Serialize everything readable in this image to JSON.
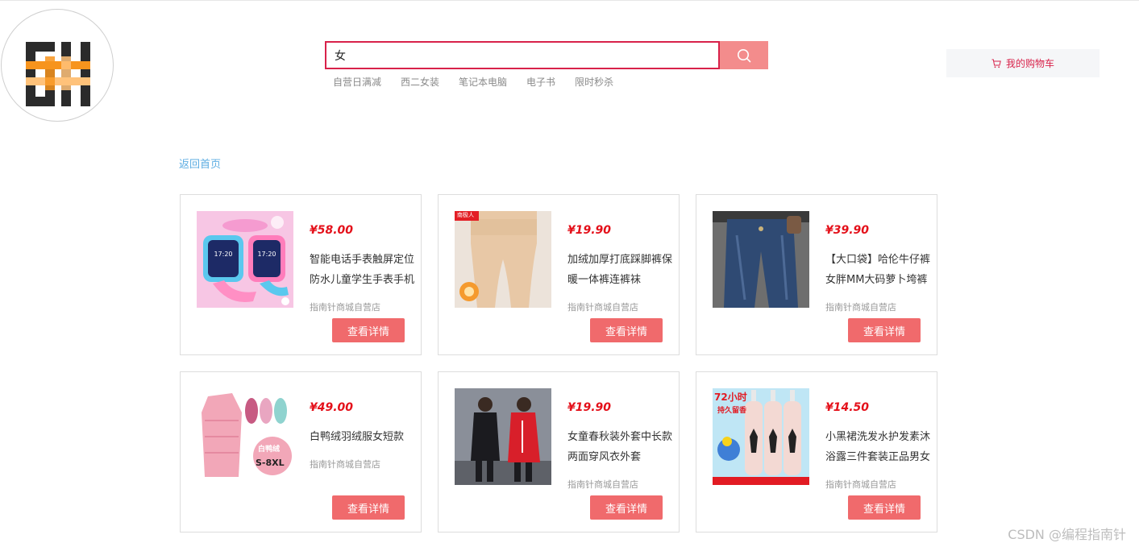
{
  "search": {
    "value": "女",
    "hot_words": [
      "自营日满减",
      "西二女装",
      "笔记本电脑",
      "电子书",
      "限时秒杀"
    ]
  },
  "cart": {
    "label": "我的购物车"
  },
  "nav": {
    "back_label": "返回首页"
  },
  "products": [
    {
      "price": "¥58.00",
      "name": "智能电话手表触屏定位防水儿童学生手表手机",
      "shop": "指南针商城自营店",
      "button": "查看详情"
    },
    {
      "price": "¥19.90",
      "name": "加绒加厚打底踩脚裤保暖一体裤连裤袜",
      "shop": "指南针商城自营店",
      "button": "查看详情",
      "badge": "南极人"
    },
    {
      "price": "¥39.90",
      "name": "【大口袋】哈伦牛仔裤女胖MM大码萝卜垮裤",
      "shop": "指南针商城自营店",
      "button": "查看详情"
    },
    {
      "price": "¥49.00",
      "name": "白鸭绒羽绒服女短款",
      "shop": "指南针商城自营店",
      "button": "查看详情",
      "tag_top": "白鸭绒",
      "tag_bottom": "S-8XL"
    },
    {
      "price": "¥19.90",
      "name": "女童春秋装外套中长款两面穿风衣外套",
      "shop": "指南针商城自营店",
      "button": "查看详情"
    },
    {
      "price": "¥14.50",
      "name": "小黑裙洗发水护发素沐浴露三件套装正品男女",
      "shop": "指南针商城自营店",
      "button": "查看详情",
      "promo_top": "72小时",
      "promo_sub": "持久留香"
    }
  ],
  "watermark": "CSDN @编程指南针",
  "colors": {
    "accent": "#d8224a",
    "button": "#f06a6c",
    "search_button": "#f38c8c",
    "price": "#e4101a",
    "link": "#5dade2"
  }
}
